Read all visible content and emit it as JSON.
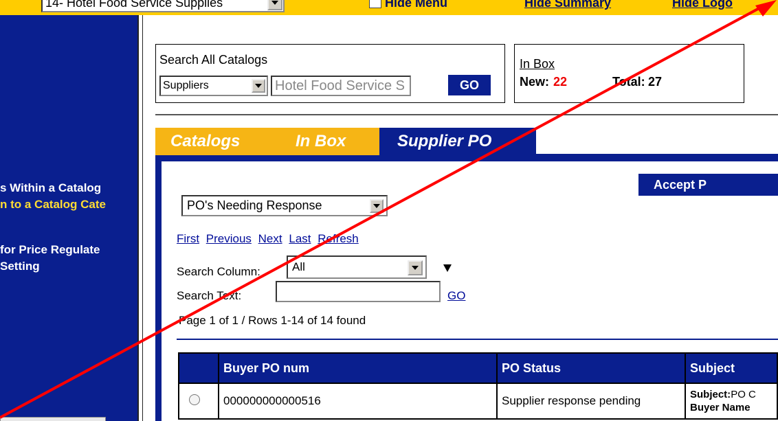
{
  "topbar": {
    "catalog_select": "14- Hotel Food Service Supplies",
    "hide_menu": "Hide Menu",
    "hide_summary": "Hide Summary",
    "hide_logo": "Hide Logo"
  },
  "sidebar": {
    "items": [
      {
        "label": "s Within a Catalog"
      },
      {
        "label": "n to a Catalog Cate"
      },
      {
        "label": "for Price Regulate"
      },
      {
        "label": " Setting"
      }
    ]
  },
  "search": {
    "title": "Search All Catalogs",
    "scope": "Suppliers",
    "value": "Hotel Food Service S",
    "go": "GO"
  },
  "inbox": {
    "title": "In Box",
    "new_label": "New:",
    "new_count": "22",
    "total_label": "Total:",
    "total_count": "27"
  },
  "tabs": [
    {
      "label": "Catalogs"
    },
    {
      "label": "In Box"
    },
    {
      "label": "Supplier PO"
    }
  ],
  "main": {
    "accept_button": "Accept P",
    "filter_select": "PO's Needing Response",
    "pager": {
      "first": "First",
      "previous": "Previous",
      "next": "Next",
      "last": "Last",
      "refresh": "Refresh"
    },
    "search_column_label": "Search Column:",
    "search_column_value": "All",
    "search_text_label": "Search Text:",
    "search_text_go": "GO",
    "rows_found": "Page 1 of 1 / Rows 1-14 of 14 found",
    "table": {
      "headers": [
        "",
        "Buyer PO num",
        "PO Status",
        "Subject"
      ],
      "rows": [
        {
          "po_num": "000000000000516",
          "status": "Supplier response pending",
          "subject_label": "Subject:",
          "subject_value": "PO C",
          "buyer_label": "Buyer Name"
        }
      ]
    }
  },
  "colors": {
    "topbar": "#ffcc00",
    "navy": "#0a1f8f",
    "tab_yellow": "#f6b515",
    "arrow_red": "#ff0000",
    "new_count_red": "#e00000"
  }
}
